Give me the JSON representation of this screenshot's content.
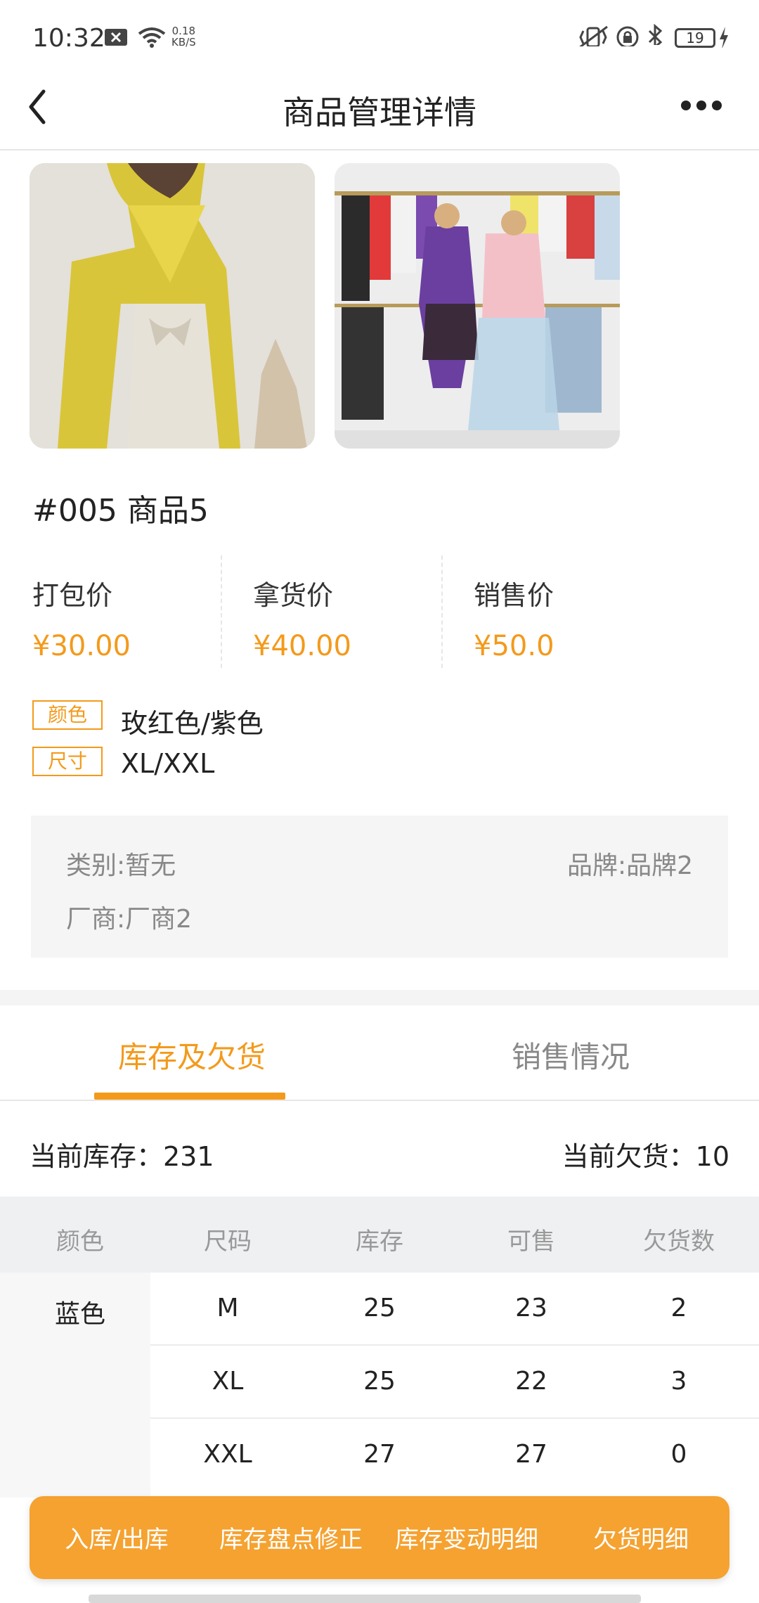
{
  "status_bar": {
    "time": "10:32",
    "net_speed_value": "0.18",
    "net_speed_unit": "KB/S",
    "battery": "19",
    "icons": [
      "close-box-icon",
      "wifi-icon",
      "vibrate-icon",
      "rotation-lock-icon",
      "bluetooth-icon",
      "battery-icon",
      "charging-icon"
    ]
  },
  "navbar": {
    "title": "商品管理详情",
    "back_icon": "chevron-left-icon",
    "more_icon": "more-horizontal-icon"
  },
  "product": {
    "title": "#005  商品5",
    "images": [
      "product-photo-yellow-cardigan",
      "product-photo-clothing-rack"
    ],
    "prices": [
      {
        "label": "打包价",
        "value": "¥30.00"
      },
      {
        "label": "拿货价",
        "value": "¥40.00"
      },
      {
        "label": "销售价",
        "value": "¥50.0"
      }
    ],
    "color_tag": "颜色",
    "color_value": "玫红色/紫色",
    "size_tag": "尺寸",
    "size_value": "XL/XXL",
    "category": "类别:暂无",
    "brand": "品牌:品牌2",
    "manufacturer": "厂商:厂商2"
  },
  "tabs": [
    {
      "label": "库存及欠货",
      "active": true
    },
    {
      "label": "销售情况",
      "active": false
    }
  ],
  "summary": {
    "stock": "当前库存：231",
    "owed": "当前欠货：10"
  },
  "table": {
    "headers": [
      "颜色",
      "尺码",
      "库存",
      "可售",
      "欠货数"
    ],
    "color": "蓝色",
    "rows": [
      {
        "size": "M",
        "stock": "25",
        "available": "23",
        "owed": "2"
      },
      {
        "size": "XL",
        "stock": "25",
        "available": "22",
        "owed": "3"
      },
      {
        "size": "XXL",
        "stock": "27",
        "available": "27",
        "owed": "0"
      }
    ]
  },
  "actions": [
    "入库/出库",
    "库存盘点修正",
    "库存变动明细",
    "欠货明细"
  ],
  "accent_color": "#f39a1b"
}
